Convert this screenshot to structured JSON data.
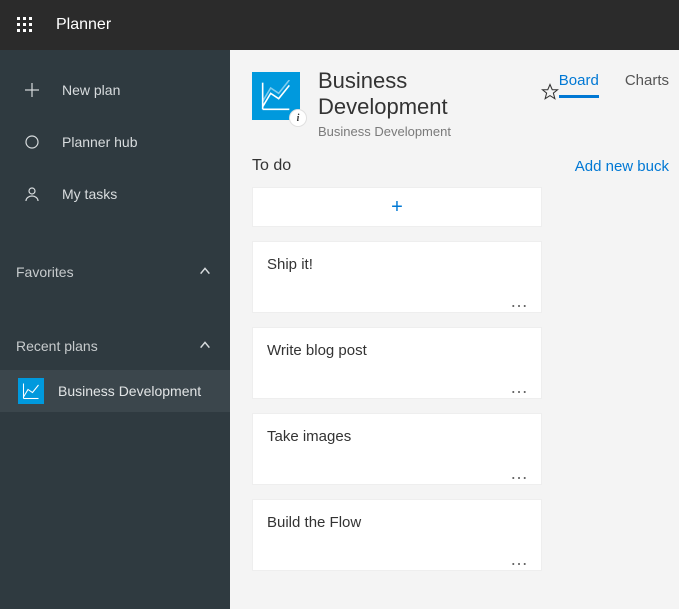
{
  "app_name": "Planner",
  "sidebar": {
    "new_plan": "New plan",
    "hub": "Planner hub",
    "my_tasks": "My tasks",
    "favorites_label": "Favorites",
    "recent_label": "Recent plans",
    "recent_items": [
      {
        "label": "Business Development"
      }
    ]
  },
  "plan": {
    "title": "Business Development",
    "subtitle": "Business Development",
    "info_badge": "i"
  },
  "tabs": {
    "board": "Board",
    "charts": "Charts"
  },
  "bucket": {
    "title": "To do",
    "add_new": "Add new buck"
  },
  "cards": [
    {
      "title": "Ship it!"
    },
    {
      "title": "Write blog post"
    },
    {
      "title": "Take images"
    },
    {
      "title": "Build the Flow"
    }
  ],
  "card_menu_glyph": "…"
}
